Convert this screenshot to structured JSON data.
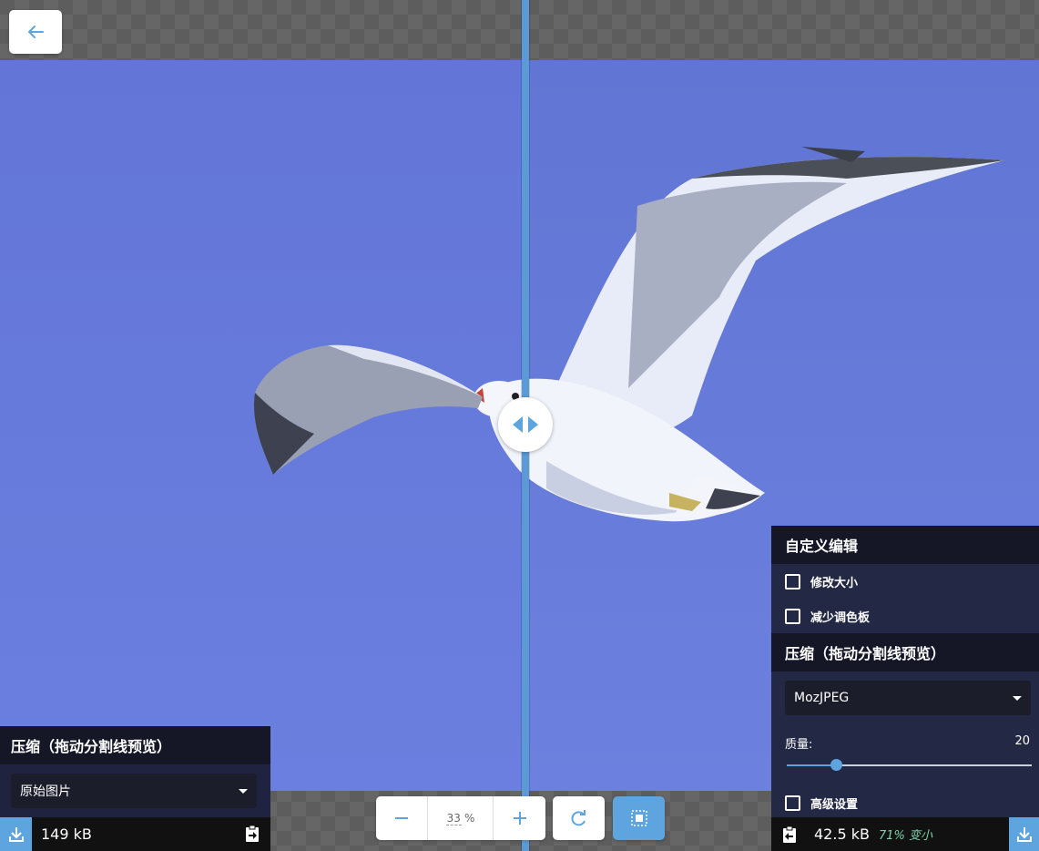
{
  "nav": {
    "back_icon": "arrow-left-icon"
  },
  "divider": {
    "handle_icon": "split-arrows-icon"
  },
  "left_panel": {
    "title": "压缩（拖动分割线预览）",
    "encoder_selected": "原始图片",
    "size": "149 kB",
    "download_icon": "download-icon",
    "copy_icon": "clipboard-arrow-right-icon"
  },
  "right_panel": {
    "edit_title": "自定义编辑",
    "resize_label": "修改大小",
    "reduce_palette_label": "减少调色板",
    "compress_title": "压缩（拖动分割线预览）",
    "encoder_selected": "MozJPEG",
    "quality_label": "质量:",
    "quality_value": "20",
    "quality_fraction": 0.2,
    "advanced_label": "高级设置",
    "size": "42.5 kB",
    "savings": "71% 变小",
    "download_icon": "download-icon",
    "copy_icon": "clipboard-arrow-left-icon"
  },
  "toolbar": {
    "zoom_out_icon": "minus-icon",
    "zoom_value": "33",
    "zoom_unit": "%",
    "zoom_in_icon": "plus-icon",
    "rotate_icon": "rotate-icon",
    "background_toggle_icon": "background-toggle-icon"
  },
  "colors": {
    "accent": "#5ea5e0",
    "panel": "#232845",
    "panel_header": "#151727",
    "savings": "#7ed3a8"
  }
}
